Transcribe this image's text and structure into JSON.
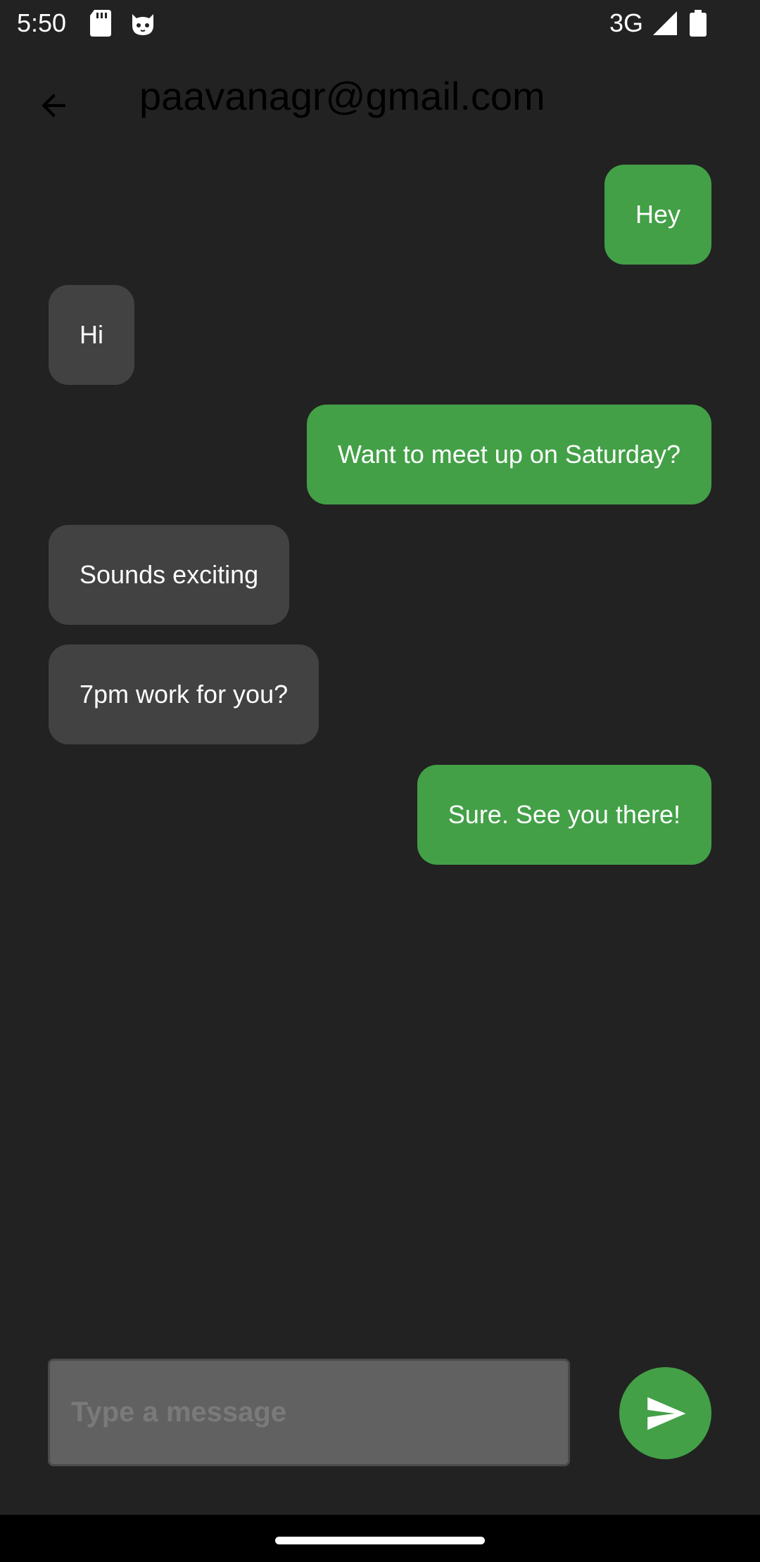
{
  "status_bar": {
    "time": "5:50",
    "network_type": "3G",
    "icons": [
      "sd-card-icon",
      "cat-icon",
      "signal-icon",
      "battery-icon"
    ]
  },
  "header": {
    "back_icon": "arrow-back-icon",
    "title": "paavanagr@gmail.com"
  },
  "messages": [
    {
      "text": "Hey",
      "direction": "sent"
    },
    {
      "text": "Hi",
      "direction": "received"
    },
    {
      "text": "Want to meet up on Saturday?",
      "direction": "sent"
    },
    {
      "text": "Sounds exciting",
      "direction": "received"
    },
    {
      "text": "7pm work for you?",
      "direction": "received"
    },
    {
      "text": "Sure. See you there!",
      "direction": "sent"
    }
  ],
  "composer": {
    "placeholder": "Type a message",
    "value": "",
    "send_icon": "send-icon"
  },
  "colors": {
    "background": "#222222",
    "sent_bubble": "#43a047",
    "received_bubble": "#424242",
    "input_background": "#616161",
    "send_button": "#43a047"
  }
}
